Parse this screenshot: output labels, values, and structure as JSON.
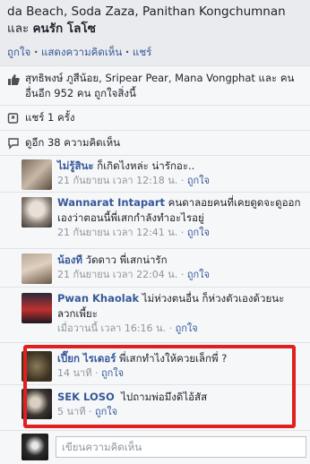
{
  "header": {
    "names_line1": "da Beach, Soda Zaza, Panithan Kongchumnan",
    "names_and": "และ",
    "names_line2": "คนรัก โลโซ"
  },
  "post_actions": {
    "like": "ถูกใจ",
    "comment": "แสดงความคิดเห็น",
    "share": "แชร์",
    "sep": "·"
  },
  "likes_row": {
    "text": "สุทธิพงษ์ ภูสีน้อย, Sripear Pear, Mana Vongphat และ คนอื่นอีก 952 คน ถูกใจสิ่งนี้"
  },
  "shares_row": {
    "text": "แชร์ 1 ครั้ง"
  },
  "comments_count_row": {
    "text": "ดูอีก 38 ความคิดเห็น"
  },
  "comments": [
    {
      "name": "ไม่รู้สินะ",
      "text": "ก็เกิดไงหล่ะ น่ารักอะ..",
      "time": "21 กันยายน เวลา 12:18 น.",
      "like": "ถูกใจ"
    },
    {
      "name": "Wannarat Intapart",
      "text": "คนดาลอยคนที่เคยดูดจะดูออกเองว่าตอนนี้พี่เสกกำลังทำอะไรอยู่",
      "time": "21 กันยายน เวลา 12:41 น.",
      "like": "ถูกใจ"
    },
    {
      "name": "น้องที",
      "text": "วัดดาว พี่เสกน่ารัก",
      "time": "21 กันยายน เวลา 22:04 น.",
      "like": "ถูกใจ"
    },
    {
      "name": "Pwan Khaolak",
      "text": "ไม่ห่วงตนอื่น ก็ห่วงตัวเองด้วยนะ ลวกเพี้ยะ",
      "time": "เมื่อวานนี้ เวลา 16:16 น.",
      "like": "ถูกใจ"
    },
    {
      "name": "เปี๊ยก ไรเดอร์",
      "text": "พี่เสกทำไงให้ควยเล็กพี่ ?",
      "time": "14 นาที",
      "like": "ถูกใจ"
    },
    {
      "name": "SEK LOSO",
      "text": "ไปถามพ่อมึงดิไอ้สัส",
      "time": "5 นาที",
      "like": "ถูกใจ"
    }
  ],
  "comment_input": {
    "placeholder": "เขียนความคิดเห็น"
  },
  "colors": {
    "highlight": "#e02020",
    "link": "#365899",
    "meta": "#90949c"
  }
}
